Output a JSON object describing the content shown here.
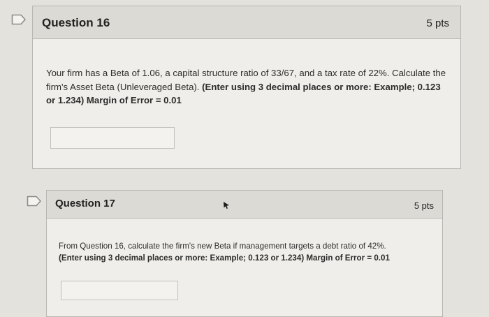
{
  "questions": [
    {
      "title": "Question 16",
      "points": "5 pts",
      "text": "Your firm has a Beta of 1.06, a capital structure ratio of 33/67, and a tax rate of 22%. Calculate the firm's Asset Beta (Unleveraged Beta). ",
      "instruction": "(Enter using 3 decimal places or more: Example; 0.123 or 1.234) Margin of Error = 0.01",
      "answer_value": ""
    },
    {
      "title": "Question 17",
      "points": "5 pts",
      "text": "From Question 16, calculate the firm's new Beta if management targets a debt ratio of 42%.",
      "instruction": "(Enter using 3 decimal places or more: Example; 0.123 or 1.234) Margin of Error = 0.01",
      "answer_value": ""
    }
  ],
  "icons": {
    "flag": "flag-question-icon",
    "cursor": "mouse-cursor-icon"
  },
  "colors": {
    "page_bg": "#e4e2dd",
    "card_bg": "#efeeea",
    "header_bg": "#dcdad5",
    "border": "#b9b7b2",
    "flag_stroke": "#8e8c88"
  }
}
